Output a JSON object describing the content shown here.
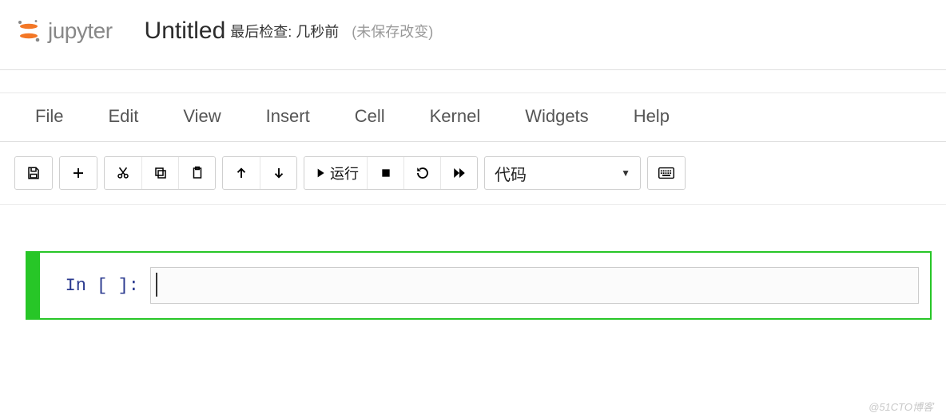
{
  "header": {
    "brand": "jupyter",
    "title": "Untitled",
    "checkpoint": "最后检查: 几秒前",
    "unsaved": "(未保存改变)"
  },
  "menu": {
    "file": "File",
    "edit": "Edit",
    "view": "View",
    "insert": "Insert",
    "cell": "Cell",
    "kernel": "Kernel",
    "widgets": "Widgets",
    "help": "Help"
  },
  "toolbar": {
    "run_label": "运行",
    "celltype_selected": "代码"
  },
  "cell": {
    "prompt": "In [ ]:",
    "input_value": ""
  },
  "watermark": "@51CTO博客"
}
